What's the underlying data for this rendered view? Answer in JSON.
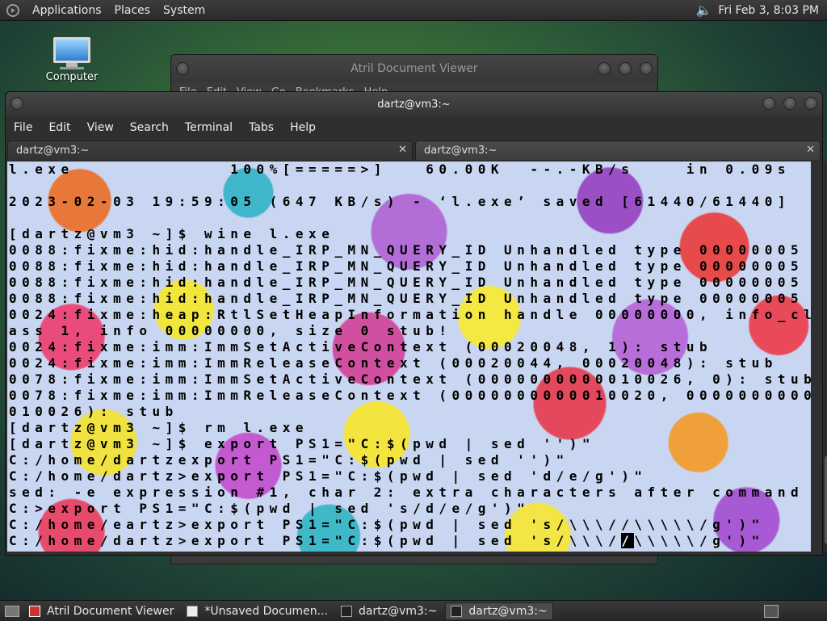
{
  "top_panel": {
    "menus": [
      "Applications",
      "Places",
      "System"
    ],
    "clock": "Fri Feb  3,  8:03 PM"
  },
  "desktop": {
    "computer_label": "Computer"
  },
  "atril": {
    "title": "Atril Document Viewer",
    "menus": [
      "File",
      "Edit",
      "View",
      "Go",
      "Bookmarks",
      "Help"
    ]
  },
  "terminal": {
    "title": "dartz@vm3:~",
    "menus": [
      "File",
      "Edit",
      "View",
      "Search",
      "Terminal",
      "Tabs",
      "Help"
    ],
    "tabs": [
      {
        "label": "dartz@vm3:~"
      },
      {
        "label": "dartz@vm3:~"
      }
    ],
    "lines": [
      "l.exe            100%[=====>]   60.00K  --.-KB/s    in 0.09s",
      "",
      "2023-02-03 19:59:05 (647 KB/s) - ‘l.exe’ saved [61440/61440]",
      "",
      "[dartz@vm3 ~]$ wine l.exe",
      "0088:fixme:hid:handle_IRP_MN_QUERY_ID Unhandled type 00000005",
      "0088:fixme:hid:handle_IRP_MN_QUERY_ID Unhandled type 00000005",
      "0088:fixme:hid:handle_IRP_MN_QUERY_ID Unhandled type 00000005",
      "0088:fixme:hid:handle_IRP_MN_QUERY_ID Unhandled type 00000005",
      "0024:fixme:heap:RtlSetHeapInformation handle 00000000, info_cl",
      "ass 1, info 00000000, size 0 stub!",
      "0024:fixme:imm:ImmSetActiveContext (00020048, 1): stub",
      "0024:fixme:imm:ImmReleaseContext (00020044, 00020048): stub",
      "0078:fixme:imm:ImmSetActiveContext (0000000000010026, 0): stub",
      "0078:fixme:imm:ImmReleaseContext (0000000000010020, 0000000000",
      "010026): stub",
      "[dartz@vm3 ~]$ rm l.exe",
      "[dartz@vm3 ~]$ export PS1=\"C:$(pwd | sed '')\"",
      "C:/home/dartzexport PS1=\"C:$(pwd | sed '')\"",
      "C:/home/dartz>export PS1=\"C:$(pwd | sed 'd/e/g')\"",
      "sed: -e expression #1, char 2: extra characters after command",
      "C:>export PS1=\"C:$(pwd | sed 's/d/e/g')\"",
      "C:/home/eartz>export PS1=\"C:$(pwd | sed 's/\\\\\\//\\\\\\\\\\/g')\""
    ],
    "last_line_before_cursor": "C:/home/dartz>export PS1=\"C:$(pwd | sed 's/\\\\\\/",
    "cursor_char": "/",
    "last_line_after_cursor": "\\\\\\\\\\/g')\""
  },
  "taskbar": {
    "tasks": [
      {
        "label": "Atril Document Viewer",
        "active": false
      },
      {
        "label": "*Unsaved Documen...",
        "active": false
      },
      {
        "label": "dartz@vm3:~",
        "active": false
      },
      {
        "label": "dartz@vm3:~",
        "active": true
      }
    ]
  }
}
